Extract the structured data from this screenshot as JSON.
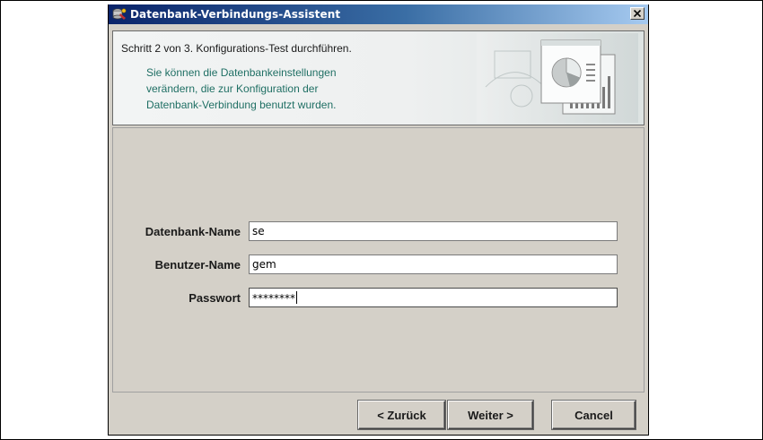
{
  "window": {
    "title": "Datenbank-Verbindungs-Assistent",
    "close_symbol": "×"
  },
  "header": {
    "step": "Schritt 2 von 3. Konfigurations-Test durchführen.",
    "description_lines": [
      "Sie können die Datenbankeinstellungen",
      "verändern, die zur Konfiguration der",
      "Datenbank-Verbindung benutzt wurden."
    ]
  },
  "form": {
    "fields": [
      {
        "label": "Datenbank-Name",
        "value": "se"
      },
      {
        "label": "Benutzer-Name",
        "value": "gem"
      },
      {
        "label": "Passwort",
        "value": "********"
      }
    ]
  },
  "buttons": {
    "back": "< Zurück",
    "next": "Weiter >",
    "cancel": "Cancel"
  },
  "colors": {
    "titlebar_start": "#0a246a",
    "titlebar_end": "#a6caf0",
    "description_text": "#1f6f64",
    "window_bg": "#d4d0c8"
  },
  "icons": {
    "app": "database-wizard-icon",
    "close": "close-icon",
    "header": "chart-report-graphic"
  }
}
